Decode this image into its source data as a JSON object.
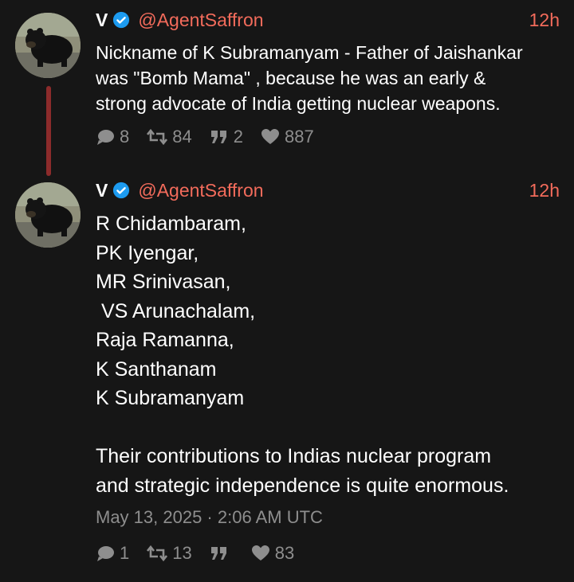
{
  "tweets": [
    {
      "display_name": "V",
      "handle": "@AgentSaffron",
      "time": "12h",
      "text": "Nickname of K Subramanyam - Father of Jaishankar\nwas \"Bomb Mama\" , because he was an early &\nstrong advocate of India getting nuclear weapons.",
      "replies": "8",
      "retweets": "84",
      "quotes": "2",
      "likes": "887"
    },
    {
      "display_name": "V",
      "handle": "@AgentSaffron",
      "time": "12h",
      "text": "R Chidambaram,\nPK Iyengar,\nMR Srinivasan,\n VS Arunachalam,\nRaja Ramanna,\nK Santhanam\nK Subramanyam\n\nTheir contributions to Indias nuclear program\nand strategic independence is quite enormous.",
      "date": "May 13, 2025 · 2:06 AM UTC",
      "replies": "1",
      "retweets": "13",
      "quotes": "",
      "likes": "83"
    }
  ],
  "colors": {
    "background": "#161616",
    "accent": "#f26b5b",
    "muted": "#8e8e8e",
    "verified": "#1d9bf0",
    "thread_line": "#8c2b2b"
  },
  "icons": [
    "verified-badge-icon",
    "reply-icon",
    "retweet-icon",
    "quote-icon",
    "heart-icon"
  ]
}
